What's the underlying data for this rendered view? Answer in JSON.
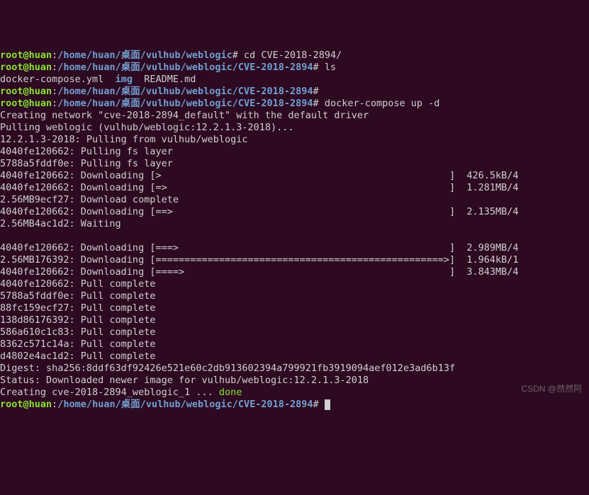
{
  "prompts": {
    "user": "root@huan",
    "sep": ":",
    "path_parent": "/home/huan/桌面/vulhub/weblogic",
    "path_cve": "/home/huan/桌面/vulhub/weblogic/CVE-2018-2894",
    "hash": "#"
  },
  "cmds": {
    "cd": "cd CVE-2018-2894/",
    "ls": "ls",
    "up": "docker-compose up -d"
  },
  "ls_output": {
    "file1": "docker-compose.yml",
    "dir1": "img",
    "file2": "README.md"
  },
  "compose": {
    "creating_network": "Creating network \"cve-2018-2894_default\" with the default driver",
    "pulling": "Pulling weblogic (vulhub/weblogic:12.2.1.3-2018)...",
    "pull_from": "12.2.1.3-2018: Pulling from vulhub/weblogic",
    "l1": "4040fe120662: Pulling fs layer",
    "l2": "5788a5fddf0e: Pulling fs layer",
    "l3": "4040fe120662: Downloading [>                                                  ]  426.5kB/4",
    "l4": "4040fe120662: Downloading [=>                                                 ]  1.281MB/4",
    "l5": "2.56MB9ecf27: Download complete",
    "l6": "4040fe120662: Downloading [==>                                                ]  2.135MB/4",
    "l7": "2.56MB4ac1d2: Waiting",
    "l8": "4040fe120662: Downloading [===>                                               ]  2.989MB/4",
    "l9": "2.56MB176392: Downloading [==================================================>]  1.964kB/1",
    "l10": "4040fe120662: Downloading [====>                                              ]  3.843MB/4",
    "l11": "4040fe120662: Pull complete",
    "l12": "5788a5fddf0e: Pull complete",
    "l13": "88fc159ecf27: Pull complete",
    "l14": "138d86176392: Pull complete",
    "l15": "586a610c1c83: Pull complete",
    "l16": "8362c571c14a: Pull complete",
    "l17": "d4802e4ac1d2: Pull complete",
    "digest": "Digest: sha256:8ddf63df92426e521e60c2db913602394a799921fb3919094aef012e3ad6b13f",
    "status": "Status: Downloaded newer image for vulhub/weblogic:12.2.1.3-2018",
    "creating_pre": "Creating cve-2018-2894_weblogic_1 ... ",
    "done": "done"
  },
  "watermark": "CSDN @然然阿"
}
